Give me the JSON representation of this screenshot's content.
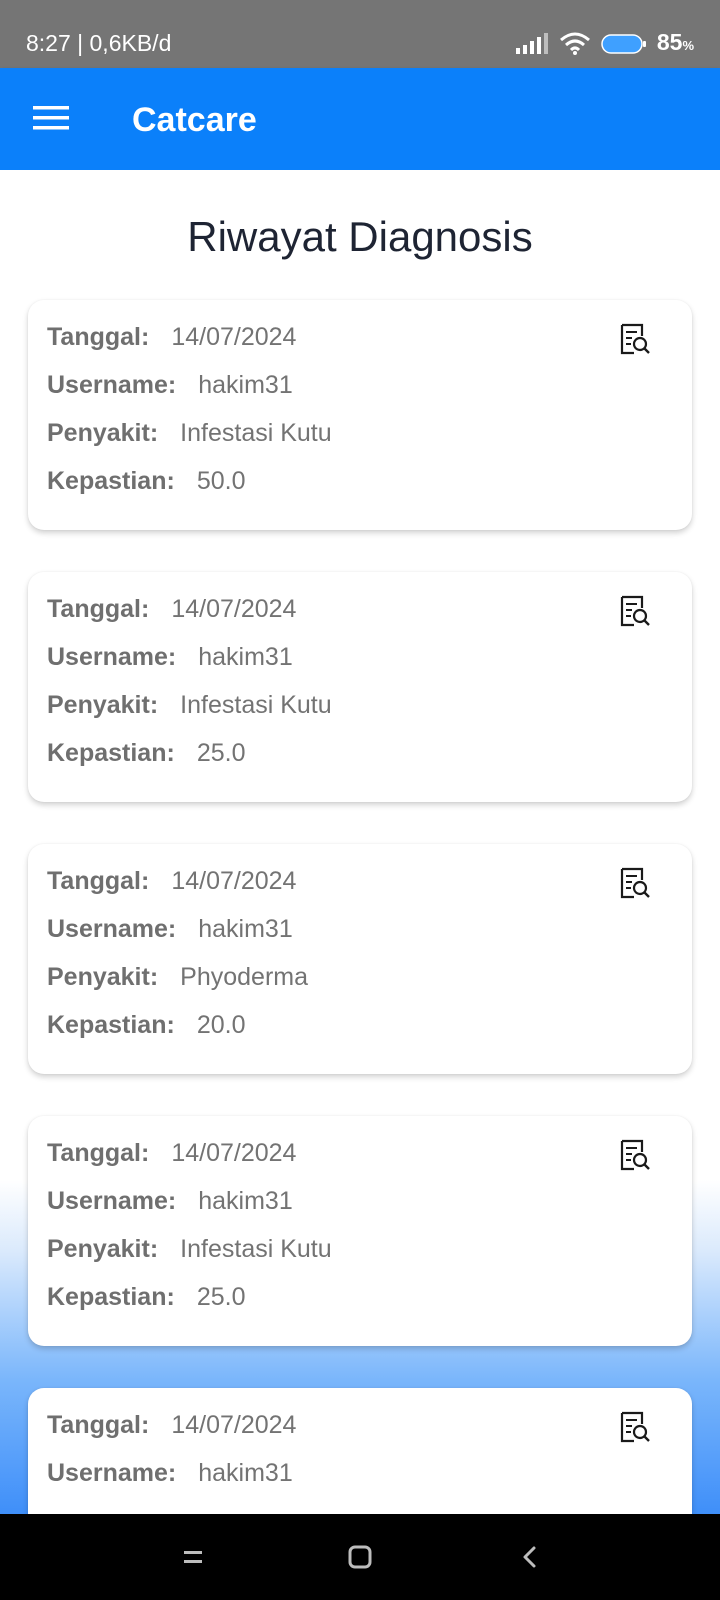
{
  "status_bar": {
    "time_speed": "8:27 | 0,6KB/d",
    "battery_level": "85",
    "battery_unit": "%",
    "icons": [
      "signal-icon",
      "wifi-icon",
      "battery-icon"
    ]
  },
  "app_bar": {
    "title": "Catcare",
    "menu_icon": "hamburger-menu-icon",
    "color": "#0b80fa"
  },
  "page": {
    "title": "Riwayat Diagnosis"
  },
  "labels": {
    "date": "Tanggal:",
    "username": "Username:",
    "disease": "Penyakit:",
    "certainty": "Kepastian:"
  },
  "records": [
    {
      "date": "14/07/2024",
      "username": "hakim31",
      "disease": "Infestasi Kutu",
      "certainty": "50.0"
    },
    {
      "date": "14/07/2024",
      "username": "hakim31",
      "disease": "Infestasi Kutu",
      "certainty": "25.0"
    },
    {
      "date": "14/07/2024",
      "username": "hakim31",
      "disease": "Phyoderma",
      "certainty": "20.0"
    },
    {
      "date": "14/07/2024",
      "username": "hakim31",
      "disease": "Infestasi Kutu",
      "certainty": "25.0"
    },
    {
      "date": "14/07/2024",
      "username": "hakim31"
    }
  ],
  "record_action_icon": "detail-search-icon",
  "nav_bar": {
    "icons": [
      "recent-apps-icon",
      "home-icon",
      "back-icon"
    ]
  }
}
